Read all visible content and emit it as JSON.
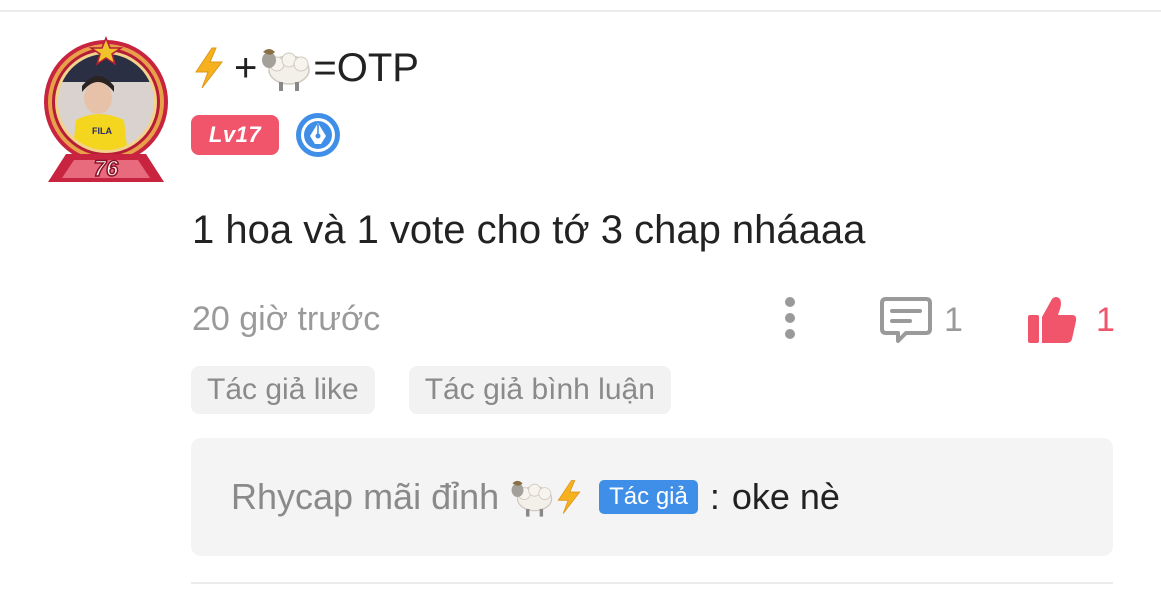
{
  "comment": {
    "user": {
      "name_suffix": "=OTP",
      "name_emoji_1": "lightning-emoji",
      "name_plus": "+",
      "name_emoji_2": "sheep-emoji",
      "level": "Lv17",
      "avatar_number": "76",
      "avatar_shirt_text": "FILA"
    },
    "text": "1 hoa và 1 vote cho tớ 3 chap nháaaa",
    "timestamp": "20 giờ trước",
    "reply_count": "1",
    "like_count": "1",
    "tags": [
      "Tác giả like",
      "Tác giả bình luận"
    ]
  },
  "reply": {
    "author": "Rhycap mãi đỉnh",
    "author_tag": "Tác giả",
    "separator": ":",
    "text": "oke nè"
  },
  "colors": {
    "accent_red": "#f0556c",
    "author_blue": "#3f8fe8",
    "muted_text": "#9a9a9a",
    "lightning": "#f5b21e"
  }
}
